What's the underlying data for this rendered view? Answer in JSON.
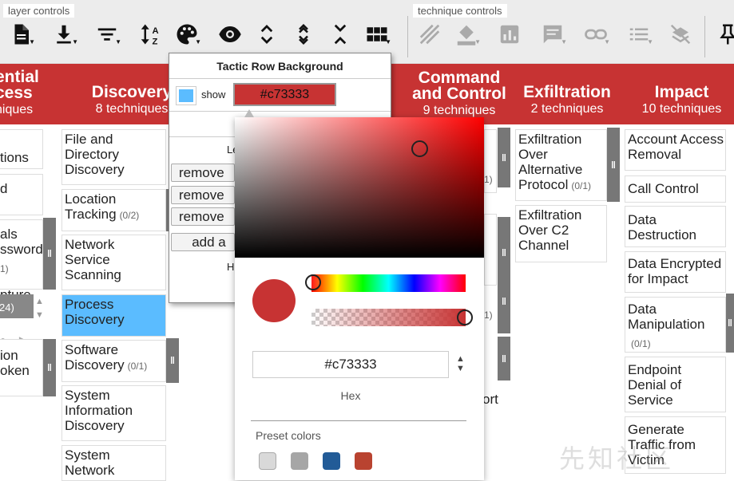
{
  "toolbar": {
    "layer_controls_label": "layer controls",
    "technique_controls_label": "technique controls",
    "layer_icons": [
      "document-icon",
      "download-icon",
      "filter-icon",
      "sort-az-icon",
      "palette-icon",
      "eye-icon",
      "expand-icon",
      "collapse-icon",
      "shrink-icon",
      "grid-icon"
    ],
    "technique_icons": [
      "selection-icon",
      "fill-color-icon",
      "score-icon",
      "comment-icon",
      "link-icon",
      "list-icon",
      "clear-icon",
      "pin-icon"
    ]
  },
  "header": {
    "bg_color": "#c73333",
    "tactics": [
      {
        "name": "ential\ncess",
        "count": "niques"
      },
      {
        "name": "Discovery",
        "count": "8  techniques"
      },
      {
        "name": "Command\nand Control",
        "count": "9  techniques"
      },
      {
        "name": "Exfiltration",
        "count": "2  techniques"
      },
      {
        "name": "Impact",
        "count": "10  techniques"
      }
    ]
  },
  "columns": {
    "credential": [
      "tions",
      "d",
      "als\nssword",
      "1)",
      "pture",
      "24)",
      "ion\noken"
    ],
    "discovery": [
      {
        "label": "File and\nDirectory\nDiscovery",
        "count": ""
      },
      {
        "label": "Location\nTracking",
        "count": "(0/2)"
      },
      {
        "label": "Network\nService\nScanning",
        "count": ""
      },
      {
        "label": "Process\nDiscovery",
        "count": ""
      },
      {
        "label": "Software\nDiscovery",
        "count": "(0/1)"
      },
      {
        "label": "System\nInformation\nDiscovery",
        "count": ""
      },
      {
        "label": "System\nNetwork",
        "count": ""
      }
    ],
    "c2_fragments": [
      "1)",
      "1)",
      "ort"
    ],
    "exfiltration": [
      {
        "label": "Exfiltration\nOver\nAlternative\nProtocol",
        "count": "(0/1)"
      },
      {
        "label": "Exfiltration\nOver C2\nChannel",
        "count": ""
      }
    ],
    "impact": [
      {
        "label": "Account Access\nRemoval",
        "count": ""
      },
      {
        "label": "Call Control",
        "count": ""
      },
      {
        "label": "Data\nDestruction",
        "count": ""
      },
      {
        "label": "Data Encrypted\nfor Impact",
        "count": ""
      },
      {
        "label": "Data\nManipulation",
        "count": "(0/1)"
      },
      {
        "label": "Endpoint\nDenial of\nService",
        "count": ""
      },
      {
        "label": "Generate\nTraffic from\nVictim",
        "count": ""
      }
    ]
  },
  "bg_popup": {
    "title": "Tactic Row Background",
    "show_label": "show",
    "swatch_color": "#5bbcff",
    "hex_value": "#c73333",
    "legend_label": "Le",
    "remove_label": "remove",
    "add_label": "add a",
    "help_label": "H"
  },
  "color_picker": {
    "current_color": "#c73333",
    "hex_value": "#c73333",
    "hex_caption": "Hex",
    "preset_label": "Preset colors",
    "presets": [
      "#d9d9d9",
      "#a6a6a6",
      "#225b97",
      "#b94330"
    ]
  },
  "watermark": "先知社区",
  "selected_color": "#5bbcff"
}
